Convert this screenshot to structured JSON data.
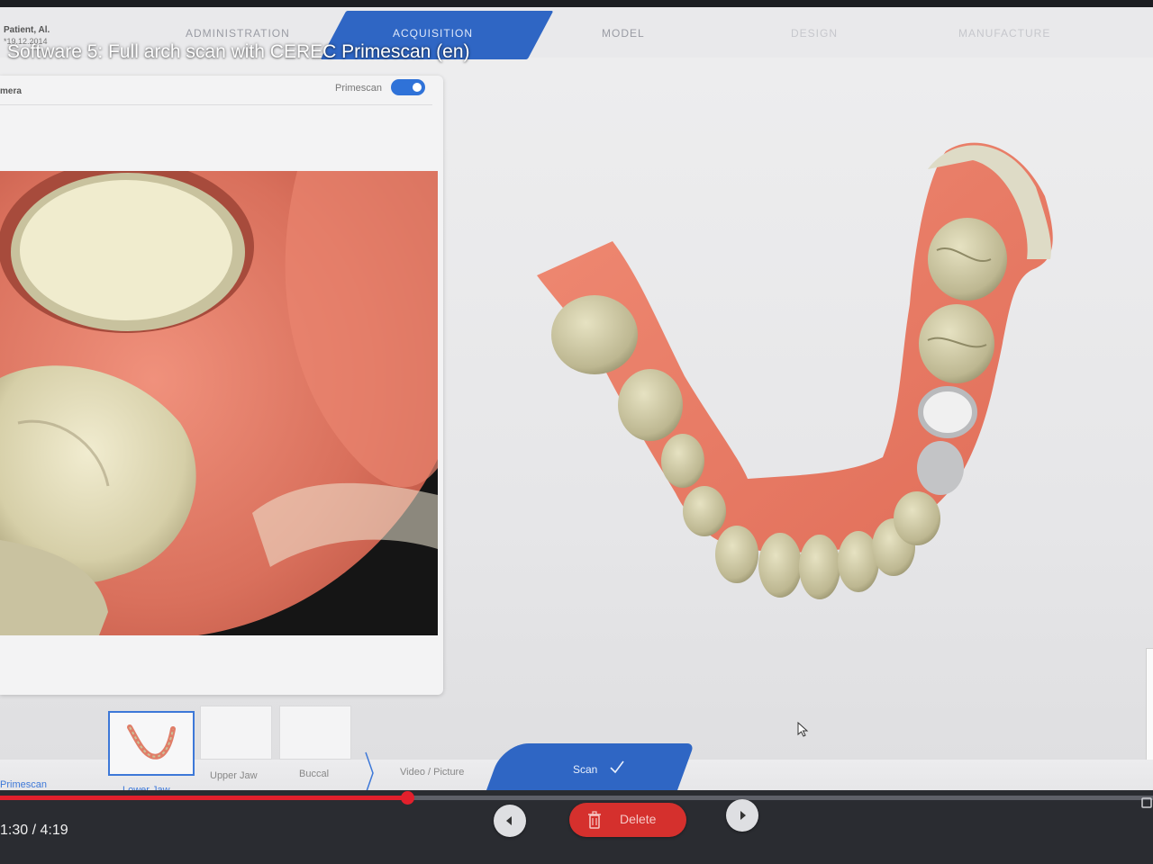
{
  "patient": {
    "name": "Patient, Al.",
    "date": "*19.12.2014"
  },
  "video_title": "Software 5: Full arch scan with CEREC Primescan (en)",
  "workflow_steps": [
    {
      "label": "ADMINISTRATION",
      "active": false
    },
    {
      "label": "ACQUISITION",
      "active": true
    },
    {
      "label": "MODEL",
      "active": false
    },
    {
      "label": "DESIGN",
      "active": false
    },
    {
      "label": "MANUFACTURE",
      "active": false
    }
  ],
  "camera_panel": {
    "title": "mera",
    "device_label": "Primescan",
    "toggle_on": true
  },
  "scan_steps": {
    "device": "Primescan",
    "catalog": [
      {
        "label": "Lower Jaw",
        "active": true
      },
      {
        "label": "Upper Jaw",
        "active": false
      },
      {
        "label": "Buccal",
        "active": false
      }
    ],
    "video_picture": "Video / Picture",
    "scan": "Scan"
  },
  "toolbar": {
    "delete_label": "Delete"
  },
  "player": {
    "current_time": "1:30",
    "duration": "4:19",
    "time_text": "1:30 / 4:19",
    "progress": 0.353
  },
  "colors": {
    "accent": "#2f66c4",
    "delete": "#d5302d",
    "progress": "#e2202c",
    "gum": "#e8806c",
    "tooth": "#c9c6a2"
  },
  "icons": {
    "back": "arrow-left-icon",
    "forward": "arrow-right-icon",
    "delete": "trash-icon",
    "scan_done": "check-icon",
    "toggle": "toggle-switch-icon",
    "cursor": "mouse-pointer-icon"
  }
}
